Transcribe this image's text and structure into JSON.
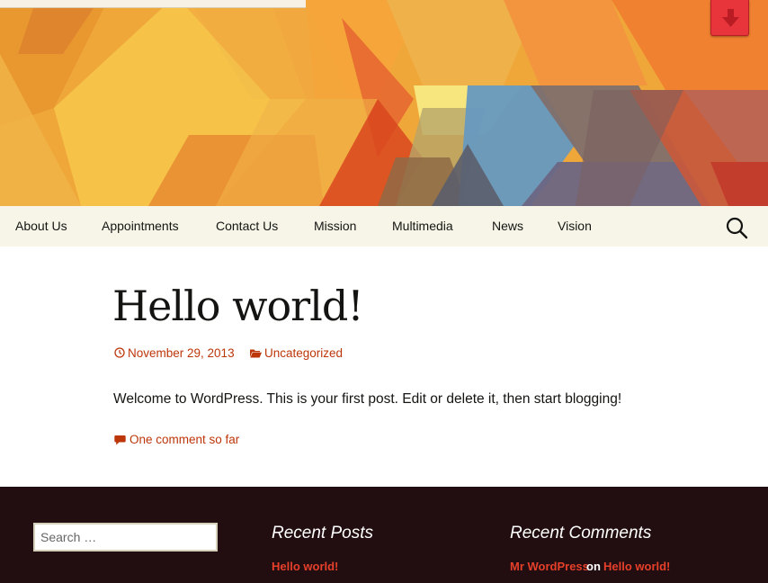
{
  "nav": {
    "items": [
      {
        "label": "About Us"
      },
      {
        "label": "Appointments"
      },
      {
        "label": "Contact Us"
      },
      {
        "label": "Mission"
      },
      {
        "label": "Multimedia"
      },
      {
        "label": "News"
      },
      {
        "label": "Vision"
      }
    ],
    "search_icon": "search-icon"
  },
  "header": {
    "download_icon": "arrow-down-icon",
    "colors": {
      "button": "#e8353b",
      "banner_base": "#f0a73a"
    }
  },
  "post": {
    "title": "Hello world!",
    "date": "November 29, 2013",
    "category": "Uncategorized",
    "body": "Welcome to WordPress. This is your first post. Edit or delete it, then start blogging!",
    "comments_link": "One comment so far"
  },
  "footer": {
    "search_placeholder": "Search …",
    "recent_posts": {
      "title": "Recent Posts",
      "items": [
        {
          "label": "Hello world!"
        }
      ]
    },
    "recent_comments": {
      "title": "Recent Comments",
      "items": [
        {
          "author": "Mr WordPress",
          "connector": "on",
          "post": "Hello world!"
        }
      ]
    }
  },
  "colors": {
    "link": "#bc360a",
    "footer_bg": "#220e10",
    "footer_link": "#e63f2a",
    "nav_bg": "#f7f5e7"
  }
}
